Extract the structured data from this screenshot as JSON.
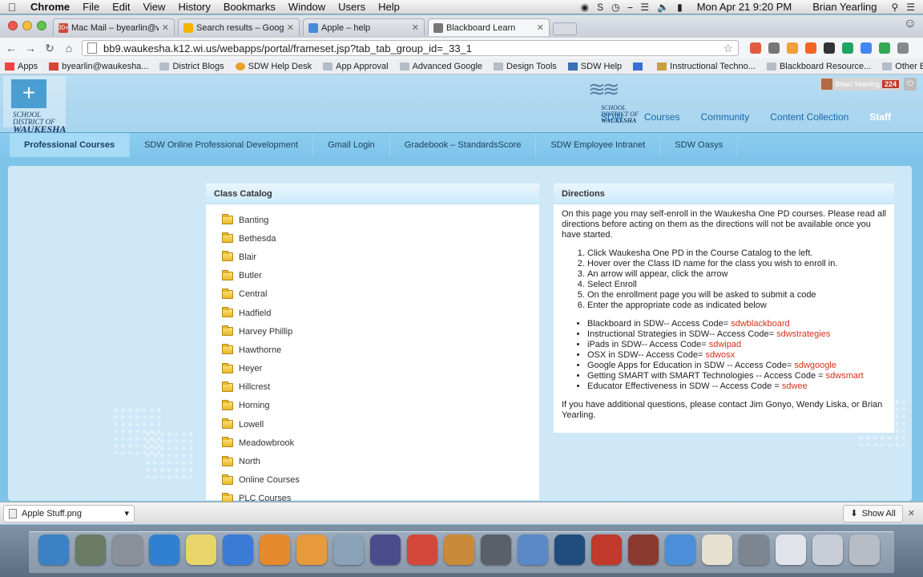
{
  "menubar": {
    "app": "Chrome",
    "items": [
      "File",
      "Edit",
      "View",
      "History",
      "Bookmarks",
      "Window",
      "Users",
      "Help"
    ],
    "datetime": "Mon Apr 21  9:20 PM",
    "user": "Brian Yearling"
  },
  "tabs": [
    {
      "title": "Mac Mail – byearlin@wauk",
      "badge": "30+",
      "color": "#d44638"
    },
    {
      "title": "Search results – Google Dr",
      "color": "#f4b400"
    },
    {
      "title": "Apple – help",
      "color": "#4a89dc"
    },
    {
      "title": "Blackboard Learn",
      "color": "#777777",
      "active": true
    }
  ],
  "omnibox": {
    "url": "bb9.waukesha.k12.wi.us/webapps/portal/frameset.jsp?tab_tab_group_id=_33_1"
  },
  "bookmarks": {
    "items": [
      "Apps",
      "byearlin@waukesha...",
      "District Blogs",
      "SDW Help Desk",
      "App Approval",
      "Advanced Google",
      "Design Tools",
      "SDW Help",
      "",
      "Instructional Techno...",
      "Blackboard Resource..."
    ],
    "other": "Other Bookmarks"
  },
  "header": {
    "logo_line1": "SCHOOL",
    "logo_line2": "DISTRICT OF",
    "logo_line3": "WAUKESHA",
    "user_name": "Brian Yearling",
    "notif_count": "224",
    "tabs": [
      "SDW",
      "Courses",
      "Community",
      "Content Collection",
      "Staff"
    ]
  },
  "subnav": [
    "Professional Courses",
    "SDW Online Professional Development",
    "Gmail Login",
    "Gradebook – StandardsScore",
    "SDW Employee Intranet",
    "SDW Oasys"
  ],
  "catalog": {
    "title": "Class Catalog",
    "items": [
      "Banting",
      "Bethesda",
      "Blair",
      "Butler",
      "Central",
      "Hadfield",
      "Harvey Phillip",
      "Hawthorne",
      "Heyer",
      "Hillcrest",
      "Horning",
      "Lowell",
      "Meadowbrook",
      "North",
      "Online Courses",
      "PLC Courses"
    ]
  },
  "directions": {
    "title": "Directions",
    "intro": "On this page you may self-enroll in the Waukesha One PD courses. Please read all directions before acting on them as the directions will not be available once you have started.",
    "steps": [
      "Click Waukesha One PD in the Course Catalog to the left.",
      "Hover over the Class ID name for the class you wish to enroll in.",
      "An arrow will appear, click the arrow",
      "Select Enroll",
      "On the enrollment page you will be asked to submit a code",
      "Enter the appropriate code as indicated below"
    ],
    "codes": [
      {
        "label": "Blackboard in SDW-- Access Code= ",
        "code": "sdwblackboard"
      },
      {
        "label": "Instructional Strategies in SDW-- Access Code= ",
        "code": "sdwstrategies"
      },
      {
        "label": "iPads in SDW-- Access Code= ",
        "code": "sdwipad"
      },
      {
        "label": "OSX in SDW-- Access Code= ",
        "code": "sdwosx"
      },
      {
        "label": "Google Apps for Education in SDW -- Access Code= ",
        "code": "sdwgoogle"
      },
      {
        "label": "Getting SMART with SMART Technologies -- Access Code = ",
        "code": "sdwsmart"
      },
      {
        "label": "Educator Effectiveness in SDW -- Access Code = ",
        "code": "sdwee"
      }
    ],
    "footer": "If you have additional questions, please contact Jim Gonyo, Wendy Liska, or Brian Yearling."
  },
  "download": {
    "file": "Apple Stuff.png",
    "show_all": "Show All"
  },
  "dock": [
    {
      "name": "finder",
      "color": "#3b82c4"
    },
    {
      "name": "preview",
      "color": "#6b7a63"
    },
    {
      "name": "launchpad",
      "color": "#8a8f99"
    },
    {
      "name": "app-store",
      "color": "#2f80d1"
    },
    {
      "name": "stickies",
      "color": "#e8d66b"
    },
    {
      "name": "itunes",
      "color": "#3a7bd5"
    },
    {
      "name": "ibooks",
      "color": "#e68a2e"
    },
    {
      "name": "pages",
      "color": "#e79a3c"
    },
    {
      "name": "iphoto",
      "color": "#8aa2b8"
    },
    {
      "name": "imovie",
      "color": "#4b4d8a"
    },
    {
      "name": "chrome",
      "color": "#d4483b"
    },
    {
      "name": "garageband",
      "color": "#c98b3a"
    },
    {
      "name": "photo-booth",
      "color": "#5a5f6a"
    },
    {
      "name": "keynote",
      "color": "#5a89c8"
    },
    {
      "name": "quicktime",
      "color": "#1f4b7d"
    },
    {
      "name": "photo-booth-2",
      "color": "#c0392b"
    },
    {
      "name": "dvd-player",
      "color": "#8b3a2f"
    },
    {
      "name": "safari",
      "color": "#4a8fd8"
    },
    {
      "name": "textedit",
      "color": "#e6e0d0"
    },
    {
      "name": "system-preferences",
      "color": "#7d8590"
    },
    {
      "name": "documents",
      "color": "#e0e4ea"
    },
    {
      "name": "downloads",
      "color": "#c9ced6"
    },
    {
      "name": "trash",
      "color": "#b8bcc4"
    }
  ]
}
